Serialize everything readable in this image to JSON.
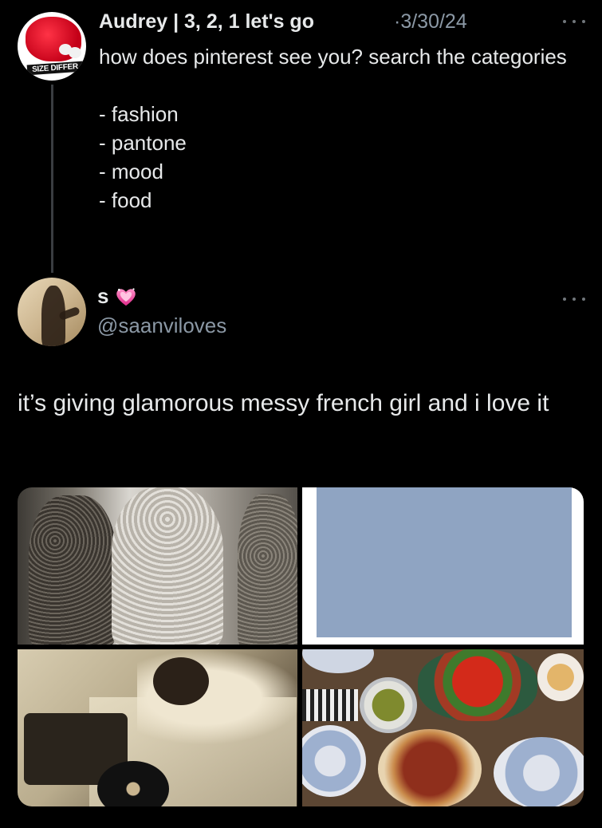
{
  "parent_tweet": {
    "author_name": "Audrey | 3, 2, 1 let's go",
    "date_separator": "·",
    "date": "3/30/24",
    "avatar_banner_text": "SIZE DIFFER",
    "text": "how does pinterest see you? search the categories\n\n- fashion\n- pantone\n- mood\n- food",
    "more_icon": "more-horizontal-icon"
  },
  "reply_tweet": {
    "author_name": "s",
    "badge_icon": "sparkling-heart-icon",
    "handle": "@saanviloves",
    "text": "it’s giving glamorous messy french girl and i love it",
    "more_icon": "more-horizontal-icon"
  },
  "media": {
    "images": [
      {
        "name": "sequin-dresses-image"
      },
      {
        "name": "pantone-swatch-image",
        "color": "#8fa4c2"
      },
      {
        "name": "vinyl-mood-image"
      },
      {
        "name": "food-table-image"
      }
    ]
  },
  "colors": {
    "background": "#000000",
    "text_primary": "#e7e9ea",
    "text_secondary": "#8b98a5",
    "thread_line": "#3a3d41"
  }
}
